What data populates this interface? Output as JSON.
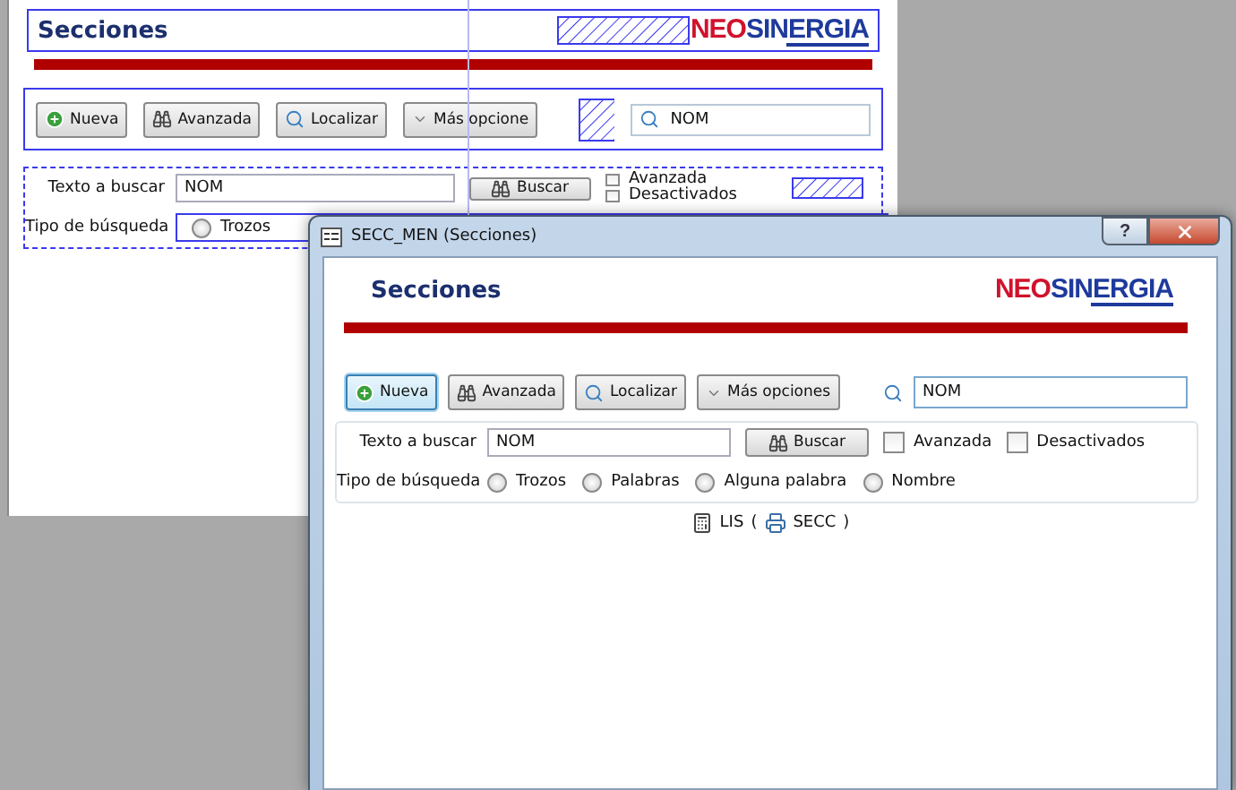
{
  "designer": {
    "header": {
      "title": "Secciones",
      "logo": {
        "part_1": "NEO",
        "part_2": "SINERGIA"
      }
    },
    "toolbar": {
      "buttons": [
        {
          "label": "Nueva",
          "kind": "plus"
        },
        {
          "label": "Avanzada",
          "kind": "binoculars"
        },
        {
          "label": "Localizar",
          "kind": "magnifier"
        },
        {
          "label": "Más opcione",
          "kind": "dropdown"
        }
      ],
      "search_value": "NOM"
    },
    "search_panel": {
      "text_label": "Texto a buscar",
      "text_value": "NOM",
      "search_button": "Buscar",
      "options": [
        {
          "label": "Avanzada",
          "checked": false
        },
        {
          "label": "Desactivados",
          "checked": false
        }
      ],
      "type_label": "Tipo de búsqueda",
      "types": [
        {
          "label": "Trozos",
          "selected": false
        }
      ]
    }
  },
  "dialog": {
    "title": "SECC_MEN (Secciones)",
    "help_button": "?",
    "header": {
      "title": "Secciones",
      "logo": {
        "part_1": "NEO",
        "part_2": "SINERGIA"
      }
    },
    "toolbar": {
      "buttons": [
        {
          "label": "Nueva",
          "kind": "plus",
          "focused": true
        },
        {
          "label": "Avanzada",
          "kind": "binoculars",
          "focused": false
        },
        {
          "label": "Localizar",
          "kind": "magnifier",
          "focused": false
        },
        {
          "label": "Más opciones",
          "kind": "dropdown",
          "focused": false
        }
      ],
      "search_value": "NOM"
    },
    "search_panel": {
      "text_label": "Texto a buscar",
      "text_value": "NOM",
      "search_button": "Buscar",
      "options": [
        {
          "label": "Avanzada",
          "checked": false
        },
        {
          "label": "Desactivados",
          "checked": false
        }
      ],
      "type_label": "Tipo de búsqueda",
      "types": [
        {
          "label": "Trozos",
          "selected": false
        },
        {
          "label": "Palabras",
          "selected": false
        },
        {
          "label": "Alguna palabra",
          "selected": false
        },
        {
          "label": "Nombre",
          "selected": false
        }
      ]
    },
    "footer": {
      "list_code": "LIS",
      "open_paren": "(",
      "section_code": "SECC",
      "close_paren": ")"
    }
  }
}
